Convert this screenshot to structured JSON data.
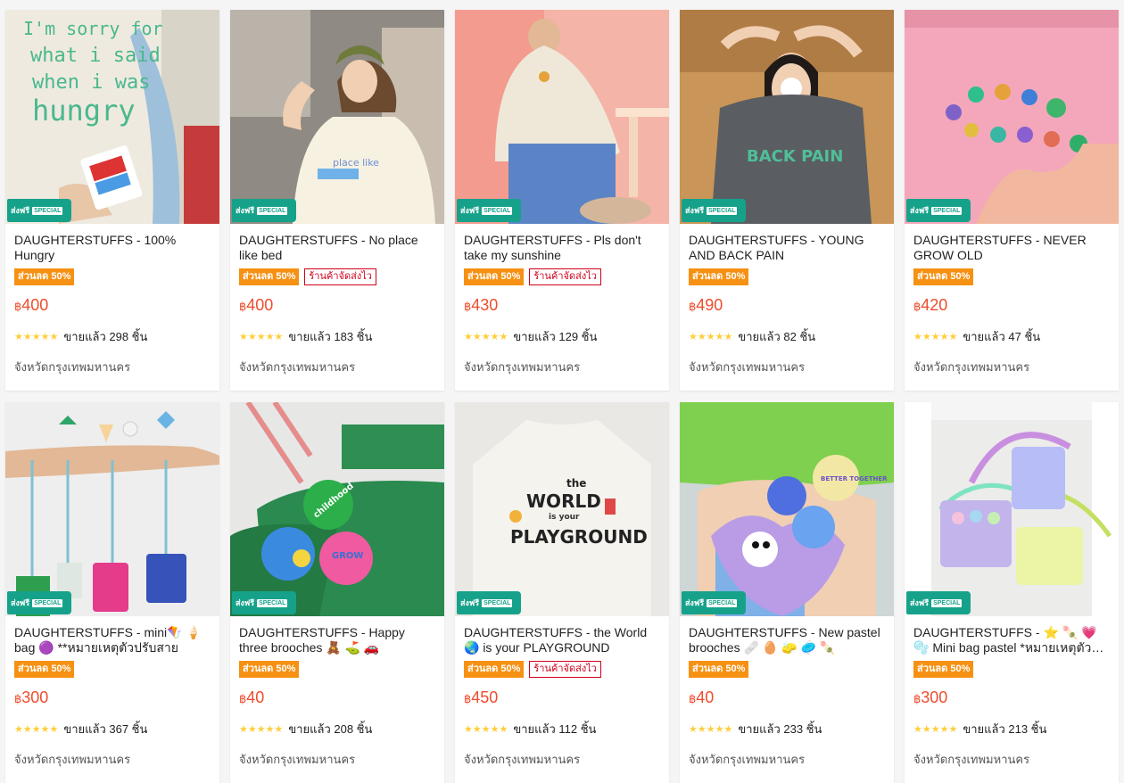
{
  "badge": {
    "free_ship": "ส่งฟรี",
    "special": "SPECIAL"
  },
  "products": [
    {
      "title": "DAUGHTERSTUFFS - 100% Hungry",
      "discount": "ส่วนลด 50%",
      "fast_ship": "",
      "currency": "฿",
      "price": "400",
      "stars": "★★★★★",
      "sold": "ขายแล้ว 298 ชิ้น",
      "location": "จังหวัดกรุงเทพมหานคร",
      "image": "tee-hungry"
    },
    {
      "title": "DAUGHTERSTUFFS - No place like bed",
      "discount": "ส่วนลด 50%",
      "fast_ship": "ร้านค้าจัดส่งไว",
      "currency": "฿",
      "price": "400",
      "stars": "★★★★★",
      "sold": "ขายแล้ว 183 ชิ้น",
      "location": "จังหวัดกรุงเทพมหานคร",
      "image": "tee-bed"
    },
    {
      "title": "DAUGHTERSTUFFS - Pls don't take my sunshine",
      "discount": "ส่วนลด 50%",
      "fast_ship": "ร้านค้าจัดส่งไว",
      "currency": "฿",
      "price": "430",
      "stars": "★★★★★",
      "sold": "ขายแล้ว 129 ชิ้น",
      "location": "จังหวัดกรุงเทพมหานคร",
      "image": "tee-sunshine"
    },
    {
      "title": "DAUGHTERSTUFFS - YOUNG AND BACK PAIN",
      "discount": "ส่วนลด 50%",
      "fast_ship": "",
      "currency": "฿",
      "price": "490",
      "stars": "★★★★★",
      "sold": "ขายแล้ว 82 ชิ้น",
      "location": "จังหวัดกรุงเทพมหานคร",
      "image": "tee-backpain"
    },
    {
      "title": "DAUGHTERSTUFFS - NEVER GROW OLD",
      "discount": "ส่วนลด 50%",
      "fast_ship": "",
      "currency": "฿",
      "price": "420",
      "stars": "★★★★★",
      "sold": "ขายแล้ว 47 ชิ้น",
      "location": "จังหวัดกรุงเทพมหานคร",
      "image": "tee-pink"
    },
    {
      "title": "DAUGHTERSTUFFS - mini🪁 🍦 bag 🟣 **หมายเหตุตัวปรับสาย",
      "discount": "ส่วนลด 50%",
      "fast_ship": "",
      "currency": "฿",
      "price": "300",
      "stars": "★★★★★",
      "sold": "ขายแล้ว 367 ชิ้น",
      "location": "จังหวัดกรุงเทพมหานคร",
      "image": "mini-bags"
    },
    {
      "title": "DAUGHTERSTUFFS - Happy three brooches 🧸 ⛳ 🚗",
      "discount": "ส่วนลด 50%",
      "fast_ship": "",
      "currency": "฿",
      "price": "40",
      "stars": "★★★★★",
      "sold": "ขายแล้ว 208 ชิ้น",
      "location": "จังหวัดกรุงเทพมหานคร",
      "image": "brooches-green"
    },
    {
      "title": "DAUGHTERSTUFFS - the World 🌏 is your PLAYGROUND",
      "discount": "ส่วนลด 50%",
      "fast_ship": "ร้านค้าจัดส่งไว",
      "currency": "฿",
      "price": "450",
      "stars": "★★★★★",
      "sold": "ขายแล้ว 112 ชิ้น",
      "location": "จังหวัดกรุงเทพมหานคร",
      "image": "tee-world"
    },
    {
      "title": "DAUGHTERSTUFFS - New pastel brooches 🩹 🥚 🧽 🥏 🍡",
      "discount": "ส่วนลด 50%",
      "fast_ship": "",
      "currency": "฿",
      "price": "40",
      "stars": "★★★★★",
      "sold": "ขายแล้ว 233 ชิ้น",
      "location": "จังหวัดกรุงเทพมหานคร",
      "image": "brooches-pastel"
    },
    {
      "title": "DAUGHTERSTUFFS - ⭐ 🍡 💗 🫧 Mini bag pastel *หมายเหตุตัวปรับสาย",
      "discount": "ส่วนลด 50%",
      "fast_ship": "",
      "currency": "฿",
      "price": "300",
      "stars": "★★★★★",
      "sold": "ขายแล้ว 213 ชิ้น",
      "location": "จังหวัดกรุงเทพมหานคร",
      "image": "mini-bag-pastel"
    }
  ],
  "image_text": {
    "hungry": [
      "I'm sorry for",
      "what i said",
      "when i was",
      "hungry"
    ],
    "backpain": "BACK PAIN",
    "world": [
      "the",
      "WORLD",
      "is your",
      "PLAYGROUND"
    ],
    "brooch1": "childhood",
    "brooch2": "GROW",
    "brooch3": "BETTER TOGETHER"
  },
  "colors": {
    "price": "#ee4d2d",
    "discount_bg": "#f69113",
    "fast_ship": "#d0011b",
    "ship_badge": "#16a28a",
    "star": "#ffce3d"
  }
}
